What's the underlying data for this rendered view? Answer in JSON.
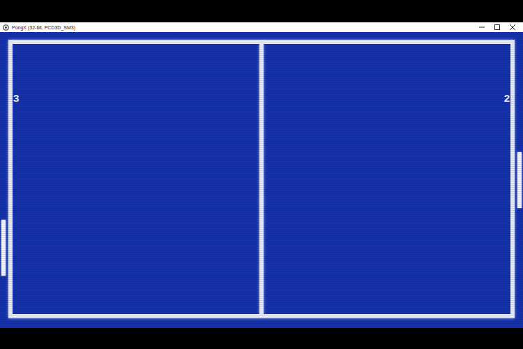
{
  "window": {
    "title": "PongX (32-bit, PCD3D_SM3)"
  },
  "score": {
    "left": "3",
    "right": "2"
  }
}
